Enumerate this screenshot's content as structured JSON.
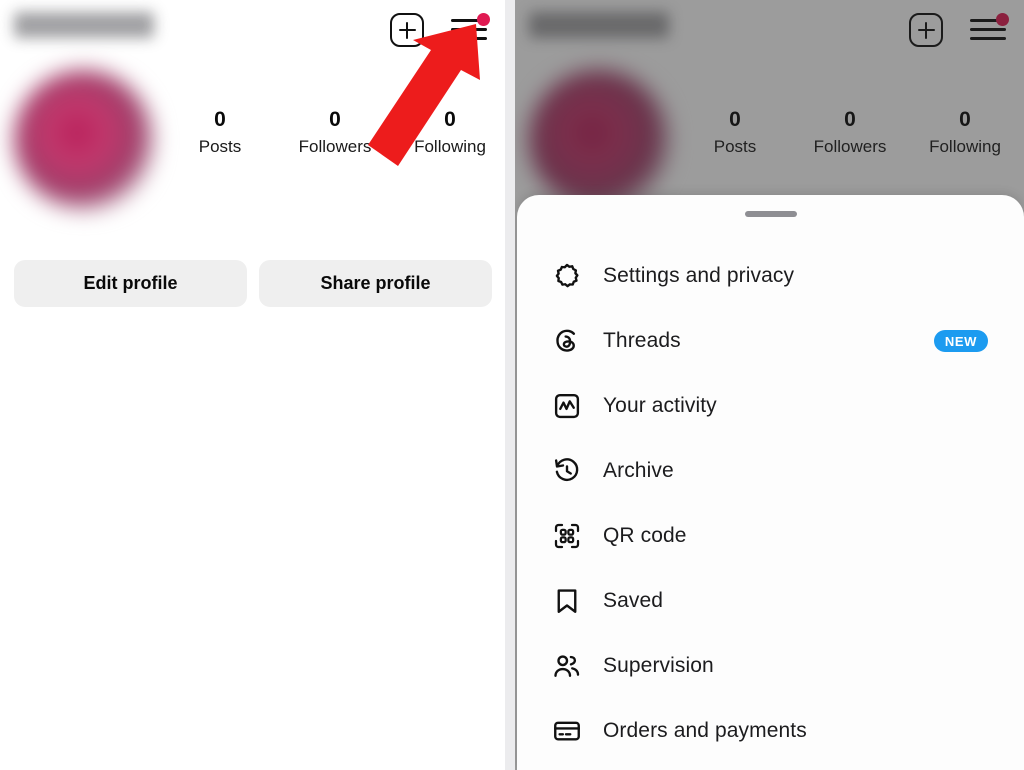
{
  "app": "Instagram profile with main menu sheet",
  "profile": {
    "username_hidden": true,
    "stats": [
      {
        "value": "0",
        "label": "Posts"
      },
      {
        "value": "0",
        "label": "Followers"
      },
      {
        "value": "0",
        "label": "Following"
      }
    ],
    "buttons": [
      {
        "label": "Edit profile"
      },
      {
        "label": "Share profile"
      }
    ],
    "header_icons": {
      "create": "plus-square-icon",
      "menu": "hamburger-menu-icon",
      "menu_has_notification_dot": true
    }
  },
  "menu_sheet": {
    "handle": "drag-handle",
    "items": [
      {
        "label": "Settings and privacy",
        "icon": "settings-gear-icon",
        "badge": ""
      },
      {
        "label": "Threads",
        "icon": "threads-icon",
        "badge": "NEW"
      },
      {
        "label": "Your activity",
        "icon": "activity-chart-icon",
        "badge": ""
      },
      {
        "label": "Archive",
        "icon": "archive-clock-icon",
        "badge": ""
      },
      {
        "label": "QR code",
        "icon": "qr-code-icon",
        "badge": ""
      },
      {
        "label": "Saved",
        "icon": "bookmark-icon",
        "badge": ""
      },
      {
        "label": "Supervision",
        "icon": "supervision-people-icon",
        "badge": ""
      },
      {
        "label": "Orders and payments",
        "icon": "credit-card-icon",
        "badge": ""
      }
    ]
  },
  "annotations": [
    {
      "name": "arrow-to-hamburger-menu",
      "direction": "up-right",
      "color": "#ed1c1c"
    },
    {
      "name": "arrow-to-your-activity",
      "direction": "left",
      "color": "#ed1c1c"
    }
  ],
  "colors": {
    "accent_badge": "#1c9bf0",
    "notification_dot": "#e01a52",
    "arrow": "#ed1c1c",
    "button_background": "#efefef"
  }
}
